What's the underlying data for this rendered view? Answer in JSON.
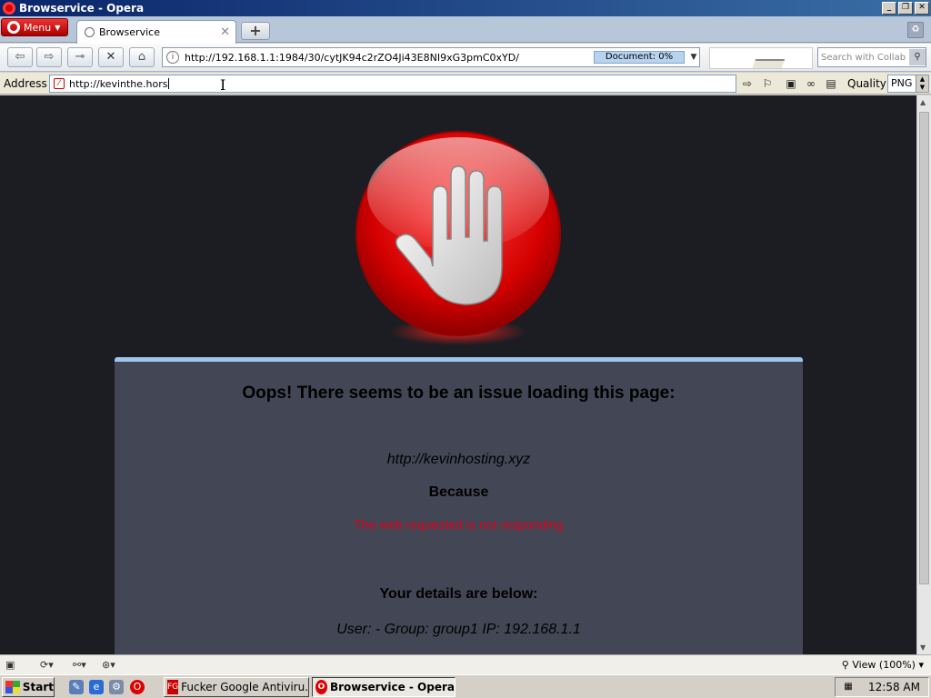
{
  "window": {
    "title": "Browservice - Opera"
  },
  "tabs": {
    "menu_label": "Menu",
    "items": [
      {
        "label": "Browservice"
      }
    ]
  },
  "navbar": {
    "url": "http://192.168.1.1:1984/30/cytJK94c2rZO4Ji43E8NI9xG3pmC0xYD/",
    "progress_label": "Document:   0%",
    "search_placeholder": "Search with Collab"
  },
  "addressbar": {
    "label": "Address",
    "value": "http://kevinthe.hors",
    "quality_label": "Quality",
    "quality_value": "PNG"
  },
  "page": {
    "heading": "Oops! There seems to be an issue loading this page:",
    "url": "http://kevinhosting.xyz",
    "because": "Because",
    "reason": "The web requested is not responding",
    "details_heading": "Your details are below:",
    "details": "User: -   Group: group1   IP: 192.168.1.1"
  },
  "statusbar": {
    "zoom": "View (100%)"
  },
  "taskbar": {
    "start_label": "Start",
    "tasks": [
      {
        "label": "Fucker Google Antiviru...",
        "icon": "fg-icon",
        "active": false
      },
      {
        "label": "Browservice - Opera",
        "icon": "opera-icon",
        "active": true
      }
    ],
    "clock": "12:58 AM"
  },
  "colors": {
    "accent_red": "#e0001a",
    "panel_bg": "#434654",
    "panel_top": "#9cc6ec",
    "page_bg": "#1c1d22"
  }
}
